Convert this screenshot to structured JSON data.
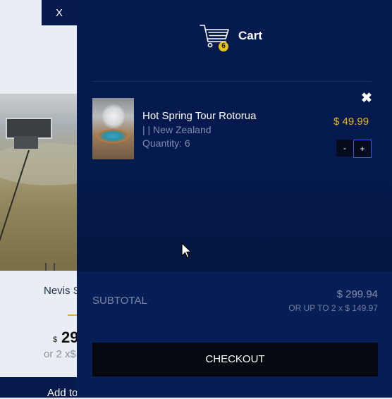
{
  "background": {
    "close_label": "X",
    "product_name": "Nevis S",
    "price_currency": "$",
    "price_partial": "29",
    "installment_partial": "or 2 x$",
    "add_button_partial": "Add to"
  },
  "cart": {
    "title": "Cart",
    "badge_count": "6",
    "remove_icon": "close-icon",
    "item": {
      "name": "Hot Spring Tour Rotorua",
      "location": "| | New Zealand",
      "quantity_text": "Quantity: 6",
      "price": "$ 49.99",
      "minus_label": "-",
      "plus_label": "+"
    },
    "subtotal_label": "SUBTOTAL",
    "subtotal_value": "$ 299.94",
    "installment_note": "OR UP TO 2 x $ 149.97",
    "checkout_label": "CHECKOUT"
  },
  "colors": {
    "drawer_bg": "#051a4f",
    "accent_gold": "#e8b820",
    "checkout_bg": "#05080f"
  }
}
